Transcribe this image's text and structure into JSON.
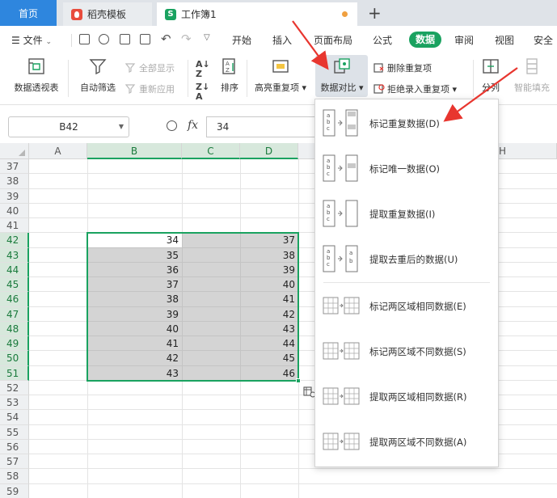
{
  "tabs": {
    "home": "首页",
    "docer": "稻壳模板",
    "workbook": "工作簿1",
    "add": "+"
  },
  "menubar": {
    "file": "文件",
    "items": [
      "开始",
      "插入",
      "页面布局",
      "公式",
      "数据",
      "审阅",
      "视图",
      "安全"
    ],
    "active": "数据"
  },
  "ribbon": {
    "pivot": "数据透视表",
    "autofilter": "自动筛选",
    "show_all": "全部显示",
    "reapply": "重新应用",
    "sort": "排序",
    "highlight_dup": "高亮重复项",
    "compare": "数据对比",
    "remove_dup": "删除重复项",
    "reject_dup": "拒绝录入重复项",
    "split": "分列",
    "smart_fill": "智能填充"
  },
  "formula": {
    "cell_ref": "B42",
    "fx": "fx",
    "value": "34"
  },
  "columns": [
    "A",
    "B",
    "C",
    "D",
    "H"
  ],
  "rows": [
    "37",
    "38",
    "39",
    "40",
    "41",
    "42",
    "43",
    "44",
    "45",
    "46",
    "47",
    "48",
    "49",
    "50",
    "51",
    "52",
    "53",
    "54",
    "55",
    "56",
    "57",
    "58",
    "59"
  ],
  "col_b_values": [
    "34",
    "35",
    "36",
    "37",
    "38",
    "39",
    "40",
    "41",
    "42",
    "43"
  ],
  "col_d_values": [
    "37",
    "38",
    "39",
    "40",
    "41",
    "42",
    "43",
    "44",
    "45",
    "46"
  ],
  "dropdown": {
    "items": [
      "标记重复数据(D)",
      "标记唯一数据(O)",
      "提取重复数据(I)",
      "提取去重后的数据(U)",
      "标记两区域相同数据(E)",
      "标记两区域不同数据(S)",
      "提取两区域相同数据(R)",
      "提取两区域不同数据(A)"
    ]
  },
  "colors": {
    "accent": "#1aa260",
    "home_tab": "#2e86de",
    "arrow": "#e8362f"
  }
}
